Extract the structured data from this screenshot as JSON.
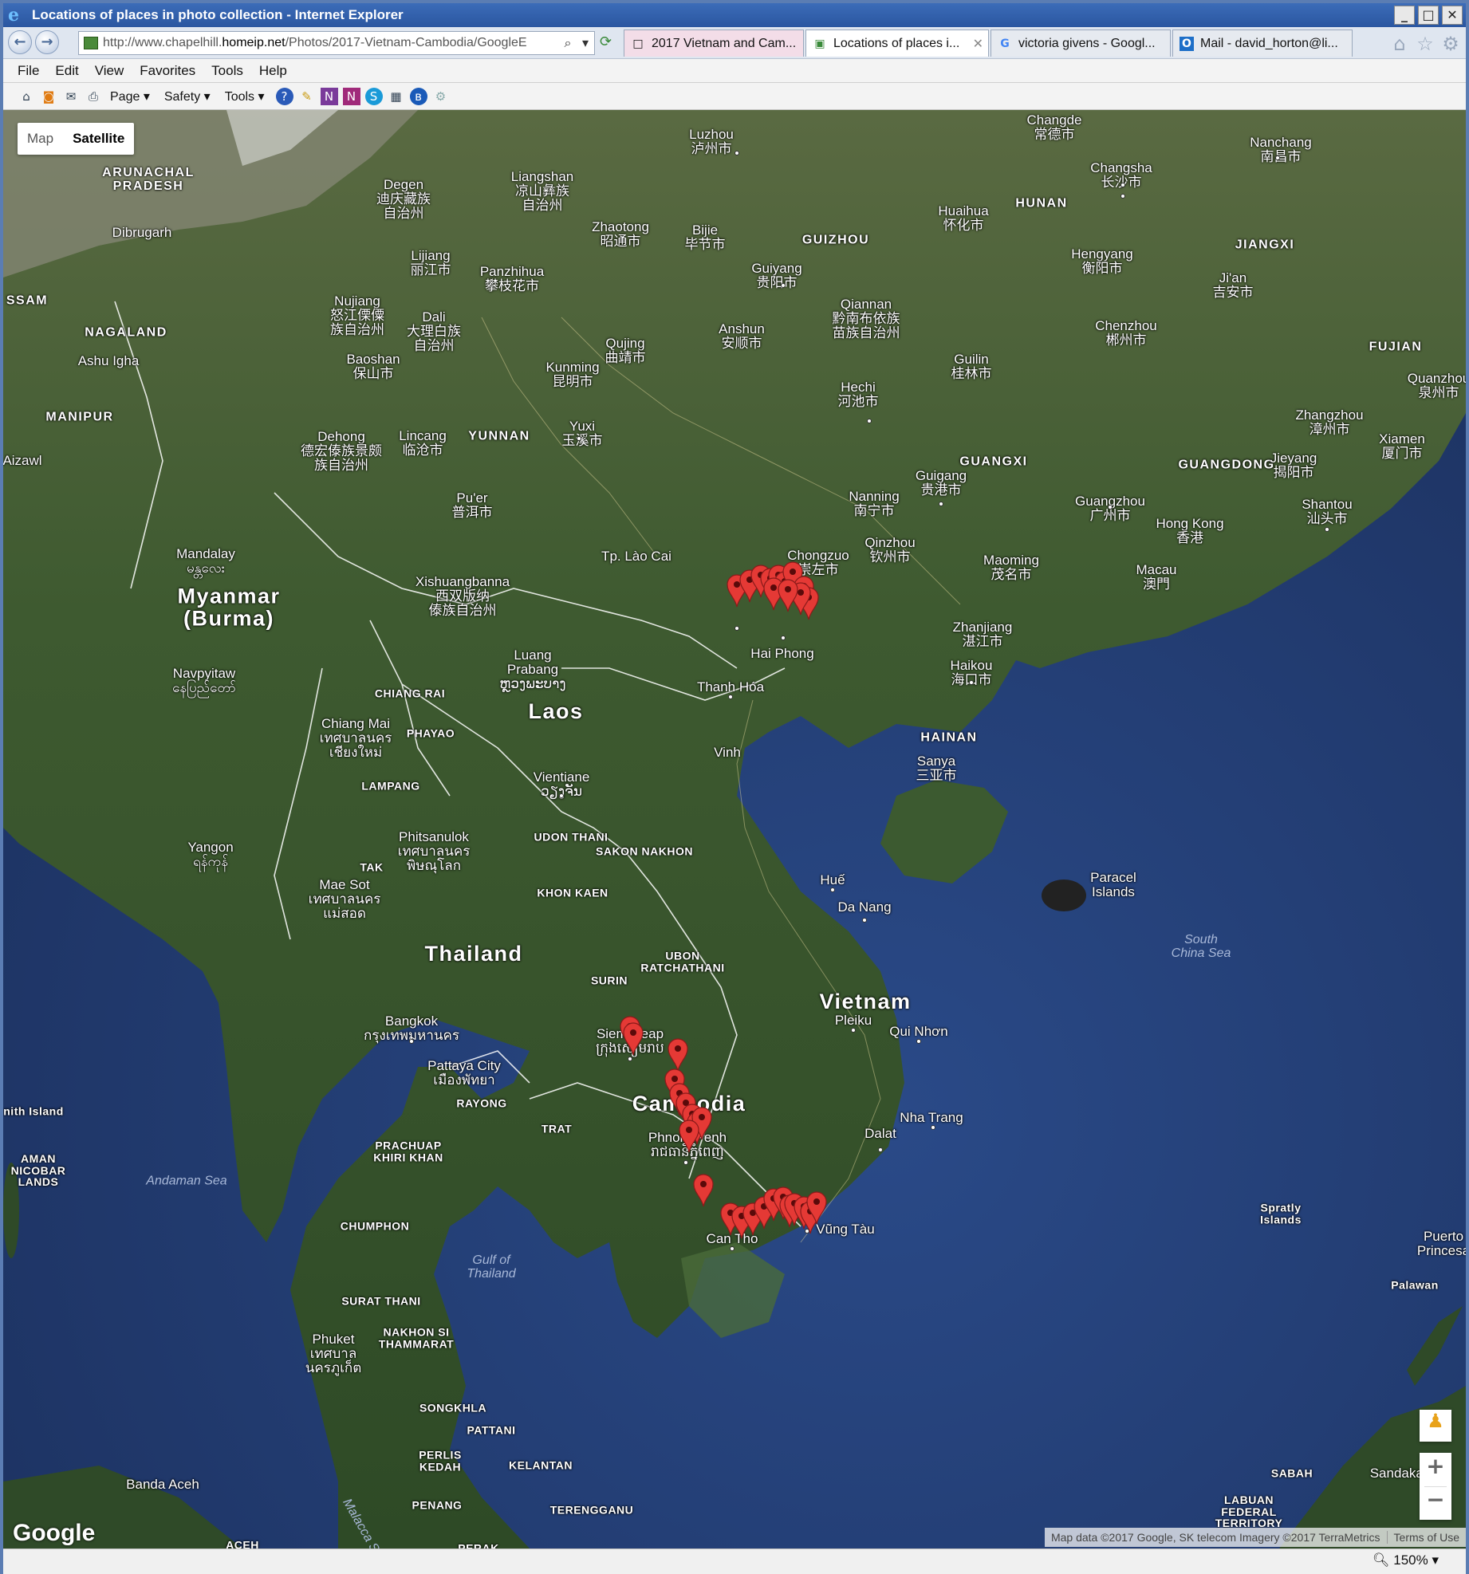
{
  "window": {
    "title": "Locations of places in photo collection - Internet Explorer",
    "minimize": "_",
    "maximize": "□",
    "close": "✕"
  },
  "nav": {
    "back_icon": "back-arrow-icon",
    "forward_icon": "forward-arrow-icon",
    "url_prefix": "http://www.chapelhill.",
    "url_host": "homeip.net",
    "url_path": "/Photos/2017-Vietnam-Cambodia/GoogleE",
    "search_glyph": "⌕",
    "dropdown_glyph": "▾",
    "refresh_glyph": "⟳"
  },
  "tabs": [
    {
      "label": "2017 Vietnam and Cam...",
      "icon": "□"
    },
    {
      "label": "Locations of places i...",
      "icon": "▣",
      "close": "✕"
    },
    {
      "label": "victoria givens - Googl...",
      "icon": "G"
    },
    {
      "label": "Mail - david_horton@li...",
      "icon": "O"
    }
  ],
  "right_icons": {
    "home": "⌂",
    "favorites": "☆",
    "settings": "⚙"
  },
  "menu": [
    "File",
    "Edit",
    "View",
    "Favorites",
    "Tools",
    "Help"
  ],
  "commandbar": {
    "page": "Page ▾",
    "safety": "Safety ▾",
    "tools": "Tools ▾",
    "help": "?"
  },
  "map": {
    "map_type": {
      "map": "Map",
      "satellite": "Satellite",
      "selected": "Satellite"
    },
    "countries": [
      {
        "text": "Laos"
      },
      {
        "text": "Thailand"
      },
      {
        "text": "Vietnam"
      },
      {
        "text": "Cambodia"
      },
      {
        "text": "Myanmar\n(Burma)"
      }
    ],
    "provinces": [
      "ARUNACHAL\nPRADESH",
      "NAGALAND",
      "MANIPUR",
      "SSAM",
      "YUNNAN",
      "GUIZHOU",
      "HUNAN",
      "JIANGXI",
      "FUJIAN",
      "GUANGXI",
      "GUANGDONG",
      "HAINAN"
    ],
    "cities": [
      "Luzhou\n泸州市",
      "Changde\n常德市",
      "Nanchang\n南昌市",
      "Changsha\n长沙市",
      "Degen\n迪庆藏族\n自治州",
      "Liangshan\n凉山彝族\n自治州",
      "Zhaotong\n昭通市",
      "Bijie\n毕节市",
      "Huaihua\n怀化市",
      "Dibrugarh",
      "Lijiang\n丽江市",
      "Panzhihua\n攀枝花市",
      "Guiyang\n贵阳市",
      "Hengyang\n衡阳市",
      "Ji'an\n吉安市",
      "Nujiang\n怒江傈僳\n族自治州",
      "Dali\n大理白族\n自治州",
      "Qujing\n曲靖市",
      "Anshun\n安顺市",
      "Qiannan\n黔南布依族\n苗族自治州",
      "Chenzhou\n郴州市",
      "Ashu Igha",
      "Baoshan\n保山市",
      "Kunming\n昆明市",
      "Guilin\n桂林市",
      "Quanzhou\n泉州市",
      "Hechi\n河池市",
      "Yuxi\n玉溪市",
      "Lincang\n临沧市",
      "Dehong\n德宏傣族景颇\n族自治州",
      "Zhangzhou\n漳州市",
      "Xiamen\n厦门市",
      "Aizawl",
      "Jieyang\n揭阳市",
      "Guigang\n贵港市",
      "Pu'er\n普洱市",
      "Nanning\n南宁市",
      "Guangzhou\n广州市",
      "Shantou\n汕头市",
      "Hong Kong\n香港",
      "Qinzhou\n钦州市",
      "Tp. Lào Cai",
      "Chongzuo\n崇左市",
      "Macau\n澳門",
      "Xishuangbanna\n西双版纳\n傣族自治州",
      "Maoming\n茂名市",
      "Mandalay\nမန္တလေး",
      "Zhanjiang\n湛江市",
      "Hai Phong",
      "Haikou\n海口市",
      "Luang\nPrabang\nຫຼວງພະບາງ",
      "Thanh Hóa",
      "Navpyitaw\nနေပြည်တော်",
      "Chiang Mai\nเทศบาลนคร\nเชียงใหม่",
      "Sanya\n三亚市",
      "Vinh",
      "Vientiane\nວຽງຈັນ",
      "Yangon\nရန်ကုန်",
      "Phitsanulok\nเทศบาลนคร\nพิษณุโลก",
      "Paracel\nIslands",
      "Huế",
      "Mae Sot\nเทศบาลนคร\nแม่สอด",
      "Da Nang",
      "Bangkok\nกรุงเทพมหานคร",
      "Pleiku",
      "Qui Nhơn",
      "Pattaya City\nเมืองพัทยา",
      "Nha Trang",
      "Phnom Penh\nរាជធានីភ្នំពេញ",
      "Dalat",
      "Can Tho",
      "Vũng Tàu",
      "Siem Reap\nក្រុងសៀមរាប",
      "Puerto\nPrincesa",
      "Phuket\nเทศบาล\nนครภูเก็ต",
      "Banda Aceh",
      "Sandakan"
    ],
    "small_regions": [
      "CHIANG RAI",
      "PHAYAO",
      "LAMPANG",
      "TAK",
      "UDON THANI",
      "SAKON NAKHON",
      "KHON KAEN",
      "UBON\nRATCHATHANI",
      "SURIN",
      "RAYONG",
      "TRAT",
      "PRACHUAP\nKHIRI KHAN",
      "CHUMPHON",
      "SURAT THANI",
      "NAKHON SI\nTHAMMARAT",
      "SONGKHLA",
      "PATTANI",
      "PERLIS\nKEDAH",
      "KELANTAN",
      "PENANG",
      "TERENGGANU",
      "ACEH",
      "PERAK",
      "SABAH",
      "LABUAN\nFEDERAL\nTERRITORY",
      "Palawan",
      "Spratly\nIslands",
      "AMAN\nNICOBAR\nLANDS",
      "nith Island"
    ],
    "seas": [
      "Andaman Sea",
      "Gulf of\nThailand",
      "South\nChina Sea",
      "Malacca Str"
    ],
    "pegman_icon": "pegman-icon",
    "zoom_in": "+",
    "zoom_out": "−",
    "google_logo": "Google",
    "attribution": "Map data ©2017 Google, SK telecom Imagery ©2017 TerraMetrics",
    "terms": "Terms of Use",
    "marker_color": "#e53935",
    "marker_count": 34
  },
  "status": {
    "zoom": "150%",
    "zoom_glyph": "▾"
  }
}
